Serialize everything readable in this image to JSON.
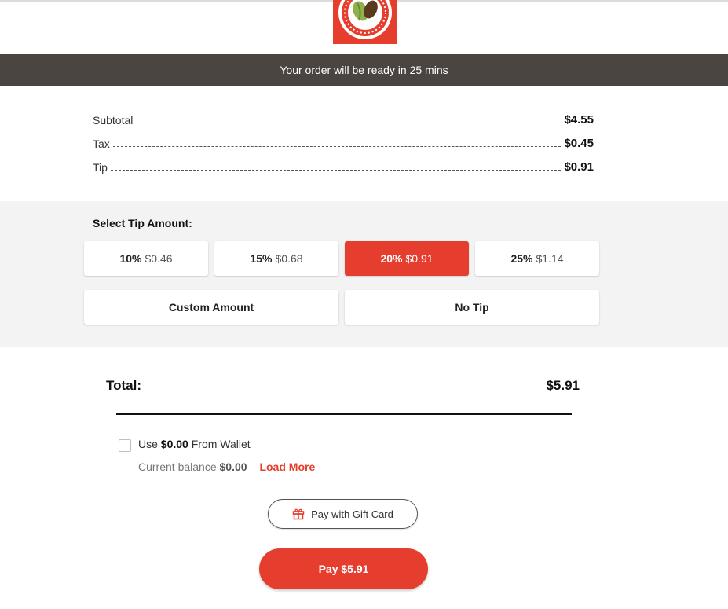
{
  "banner": {
    "text": "Your order will be ready in 25 mins"
  },
  "summary": {
    "rows": [
      {
        "label": "Subtotal",
        "amount": "$4.55"
      },
      {
        "label": "Tax",
        "amount": "$0.45"
      },
      {
        "label": "Tip",
        "amount": "$0.91"
      }
    ]
  },
  "tip": {
    "heading": "Select Tip Amount:",
    "options": [
      {
        "percent": "10%",
        "amount": "$0.46",
        "selected": false
      },
      {
        "percent": "15%",
        "amount": "$0.68",
        "selected": false
      },
      {
        "percent": "20%",
        "amount": "$0.91",
        "selected": true
      },
      {
        "percent": "25%",
        "amount": "$1.14",
        "selected": false
      }
    ],
    "custom_label": "Custom Amount",
    "no_tip_label": "No Tip"
  },
  "total": {
    "label": "Total:",
    "amount": "$5.91"
  },
  "wallet": {
    "use_prefix": "Use",
    "use_amount": "$0.00",
    "use_suffix": "From Wallet",
    "checked": false,
    "balance_label": "Current balance",
    "balance_amount": "$0.00",
    "load_more": "Load More"
  },
  "gift_card": {
    "label": "Pay with Gift Card",
    "icon": "gift-icon"
  },
  "pay": {
    "label": "Pay $5.91"
  },
  "colors": {
    "accent": "#e63e2e",
    "banner": "#4a4541",
    "tip_bg": "#f3f3f3"
  }
}
